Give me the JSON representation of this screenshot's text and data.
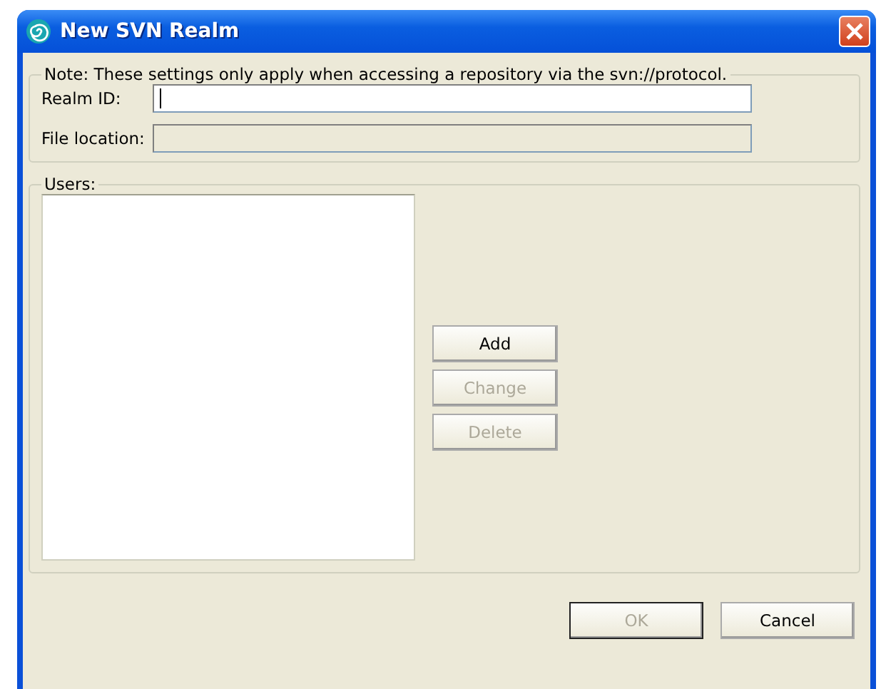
{
  "window": {
    "title": "New SVN Realm"
  },
  "settings": {
    "legend": "Note:  These settings only apply when accessing a repository via the svn://protocol.",
    "fields": [
      {
        "label": "Realm ID:",
        "disabled": false,
        "focused": true
      },
      {
        "label": "File location:",
        "disabled": true,
        "focused": false
      }
    ]
  },
  "users": {
    "legend": "Users:",
    "buttons": [
      {
        "label": "Add",
        "disabled": false
      },
      {
        "label": "Change",
        "disabled": true
      },
      {
        "label": "Delete",
        "disabled": true
      }
    ]
  },
  "footer_buttons": [
    {
      "label": "OK",
      "disabled": true,
      "default": true
    },
    {
      "label": "Cancel",
      "disabled": false,
      "default": false
    }
  ]
}
